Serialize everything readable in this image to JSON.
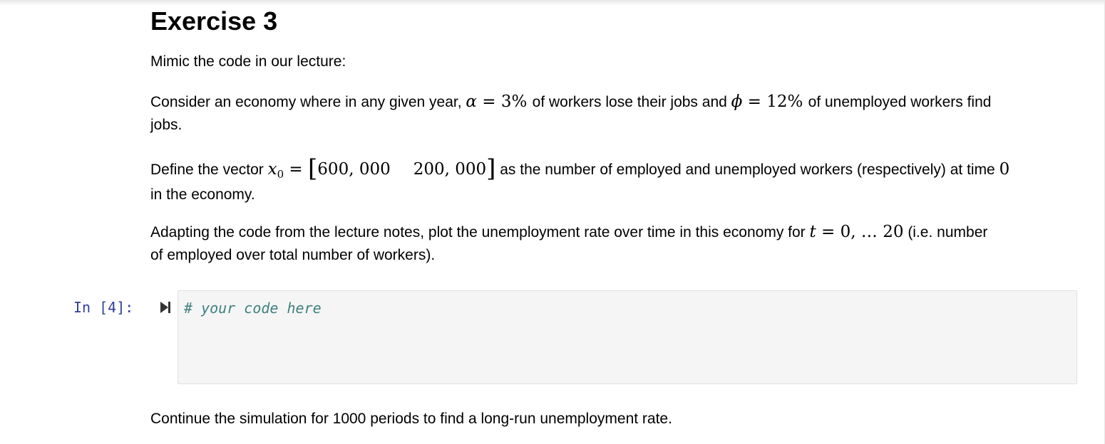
{
  "heading": "Exercise 3",
  "intro": "Mimic the code in our lecture:",
  "para_consider": {
    "t1": "Consider an economy where in any given year, ",
    "alpha": "α",
    "eq1": " = 3% ",
    "t2": "of workers lose their jobs and ",
    "phi": "ϕ",
    "eq2": " = 12% ",
    "t3": "of unemployed workers find",
    "t4": "jobs."
  },
  "para_define": {
    "t1": "Define the vector ",
    "x": "x",
    "sub": "0",
    "eq": " = ",
    "v1": "600, 000",
    "v2": "200, 000",
    "t2": " as the number of employed and unemployed workers (respectively) at time ",
    "zero": "0",
    "t3": "in the economy."
  },
  "para_adapt": {
    "t1": "Adapting the code from the lecture notes, plot the unemployment rate over time in this economy for ",
    "t": "t",
    "range": " = 0, … 20",
    "t2": " (i.e. number",
    "t3": "of employed over total number of workers)."
  },
  "cell": {
    "prompt": "In [4]:",
    "run_icon": "run-cell-icon",
    "code": "# your code here"
  },
  "continue_text": "Continue the simulation for 1000 periods to find a long-run unemployment rate."
}
